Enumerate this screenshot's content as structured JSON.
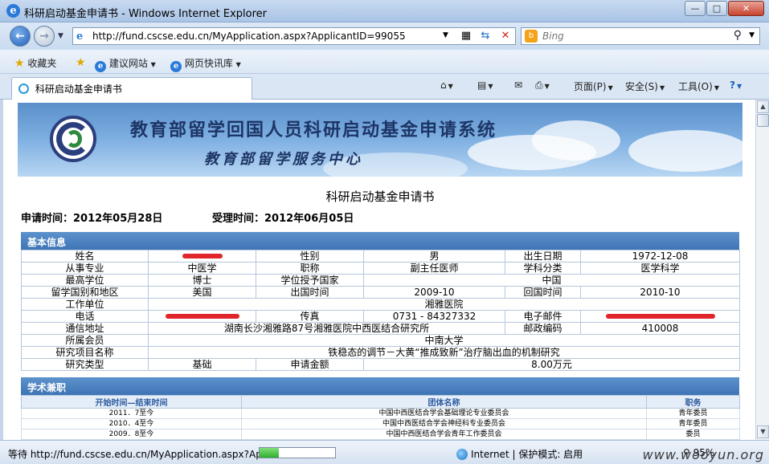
{
  "window": {
    "title": "科研启动基金申请书 - Windows Internet Explorer",
    "minimize": "—",
    "maximize": "□",
    "close": "✕"
  },
  "address": {
    "url": "http://fund.cscse.edu.cn/MyApplication.aspx?ApplicantID=99055",
    "search_placeholder": "Bing"
  },
  "favorites": {
    "label": "收藏夹",
    "items": [
      "建议网站",
      "网页快讯库"
    ]
  },
  "tab": {
    "label": "科研启动基金申请书"
  },
  "commands": {
    "page": "页面(P)",
    "safety": "安全(S)",
    "tools": "工具(O)"
  },
  "banner": {
    "title": "教育部留学回国人员科研启动基金申请系统",
    "subtitle": "教育部留学服务中心"
  },
  "doc": {
    "title": "科研启动基金申请书",
    "apply_time": "申请时间：2012年05月28日",
    "accept_time": "受理时间：2012年06月05日"
  },
  "basic": {
    "heading": "基本信息",
    "name_label": "姓名",
    "gender_label": "性别",
    "gender": "男",
    "birth_label": "出生日期",
    "birth": "1972-12-08",
    "major_label": "从事专业",
    "major": "中医学",
    "title_label": "职称",
    "title": "副主任医师",
    "subject_label": "学科分类",
    "subject": "医学科学",
    "degree_label": "最高学位",
    "degree": "博士",
    "degree_country_label": "学位授予国家",
    "degree_country": "中国",
    "abroad_label": "留学国别和地区",
    "abroad": "美国",
    "leave_label": "出国时间",
    "leave": "2009-10",
    "return_label": "回国时间",
    "return": "2010-10",
    "employer_label": "工作单位",
    "employer": "湘雅医院",
    "phone_label": "电话",
    "fax_label": "传真",
    "fax": "0731 - 84327332",
    "email_label": "电子邮件",
    "address_label": "通信地址",
    "address": "湖南长沙湘雅路87号湘雅医院中西医结合研究所",
    "zip_label": "邮政编码",
    "zip": "410008",
    "member_label": "所属会员",
    "member": "中南大学",
    "project_label": "研究项目名称",
    "project": "铁稳态的调节－大黄“推成致新”治疗脑出血的机制研究",
    "type_label": "研究类型",
    "type": "基础",
    "amount_label": "申请金额",
    "amount": "8.00万元"
  },
  "academic": {
    "heading": "学术兼职",
    "col_period": "开始时间—结束时间",
    "col_org": "团体名称",
    "col_role": "职务",
    "rows": [
      {
        "period": "2011．7至今",
        "org": "中国中西医结合学会基础理论专业委员会",
        "role": "青年委员"
      },
      {
        "period": "2010．4至今",
        "org": "中国中西医结合学会神经科专业委员会",
        "role": "青年委员"
      },
      {
        "period": "2009．8至今",
        "org": "中国中西医结合学会青年工作委员会",
        "role": "委员"
      }
    ]
  },
  "status": {
    "text": "等待 http://fund.cscse.edu.cn/MyApplication.aspx?Ap",
    "progress": 0.25,
    "zone": "Internet | 保护模式: 启用",
    "zoom": "95%",
    "watermark": "www.wooyun.org"
  }
}
